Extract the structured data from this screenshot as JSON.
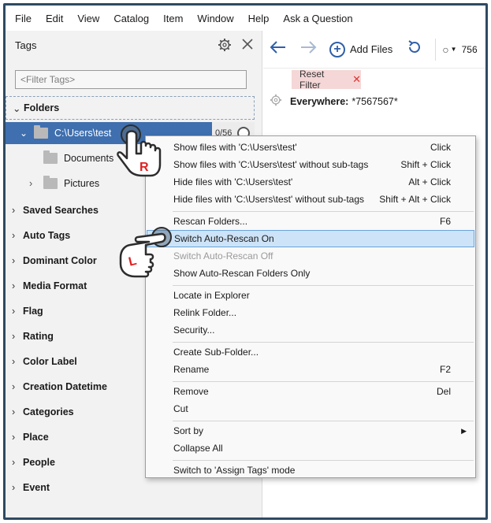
{
  "menubar": [
    "File",
    "Edit",
    "View",
    "Catalog",
    "Item",
    "Window",
    "Help",
    "Ask a Question"
  ],
  "tags_panel": {
    "title": "Tags",
    "filter_placeholder": "<Filter Tags>",
    "folders_label": "Folders",
    "tree": {
      "root": {
        "label": "C:\\Users\\test",
        "count": "0/56"
      },
      "children": [
        "Documents",
        "Pictures"
      ]
    },
    "sections": [
      "Saved Searches",
      "Auto Tags",
      "Dominant Color",
      "Media Format",
      "Flag",
      "Rating",
      "Color Label",
      "Creation Datetime",
      "Categories",
      "Place",
      "People",
      "Event"
    ]
  },
  "toolbar": {
    "add_files": "Add Files",
    "search_value": "756"
  },
  "filter": {
    "reset_label": "Reset Filter",
    "everywhere_label": "Everywhere:",
    "everywhere_value": "*7567567*"
  },
  "context_menu": {
    "groups": [
      [
        {
          "label": "Show files with 'C:\\Users\\test'",
          "shortcut": "Click"
        },
        {
          "label": "Show files with 'C:\\Users\\test' without sub-tags",
          "shortcut": "Shift + Click"
        },
        {
          "label": "Hide files with 'C:\\Users\\test'",
          "shortcut": "Alt + Click"
        },
        {
          "label": "Hide files with 'C:\\Users\\test' without sub-tags",
          "shortcut": "Shift + Alt + Click"
        }
      ],
      [
        {
          "label": "Rescan Folders...",
          "shortcut": "F6"
        },
        {
          "label": "Switch Auto-Rescan On",
          "shortcut": "",
          "highlighted": true
        },
        {
          "label": "Switch Auto-Rescan Off",
          "shortcut": "",
          "disabled": true
        },
        {
          "label": "Show Auto-Rescan Folders Only",
          "shortcut": ""
        }
      ],
      [
        {
          "label": "Locate in Explorer",
          "shortcut": ""
        },
        {
          "label": "Relink Folder...",
          "shortcut": ""
        },
        {
          "label": "Security...",
          "shortcut": ""
        }
      ],
      [
        {
          "label": "Create Sub-Folder...",
          "shortcut": ""
        },
        {
          "label": "Rename",
          "shortcut": "F2"
        }
      ],
      [
        {
          "label": "Remove",
          "shortcut": "Del"
        },
        {
          "label": "Cut",
          "shortcut": ""
        }
      ],
      [
        {
          "label": "Sort by",
          "shortcut": "",
          "submenu": true
        },
        {
          "label": "Collapse All",
          "shortcut": ""
        }
      ],
      [
        {
          "label": "Switch to 'Assign Tags' mode",
          "shortcut": ""
        }
      ]
    ]
  },
  "annotations": {
    "right_click_letter": "R",
    "left_click_letter": "L"
  },
  "colors": {
    "selected": "#3f6fae",
    "accent": "#2f5fa8",
    "highlight": "#cde3f7",
    "reset_bg": "#f5d7d7",
    "frame": "#2f4a63"
  }
}
